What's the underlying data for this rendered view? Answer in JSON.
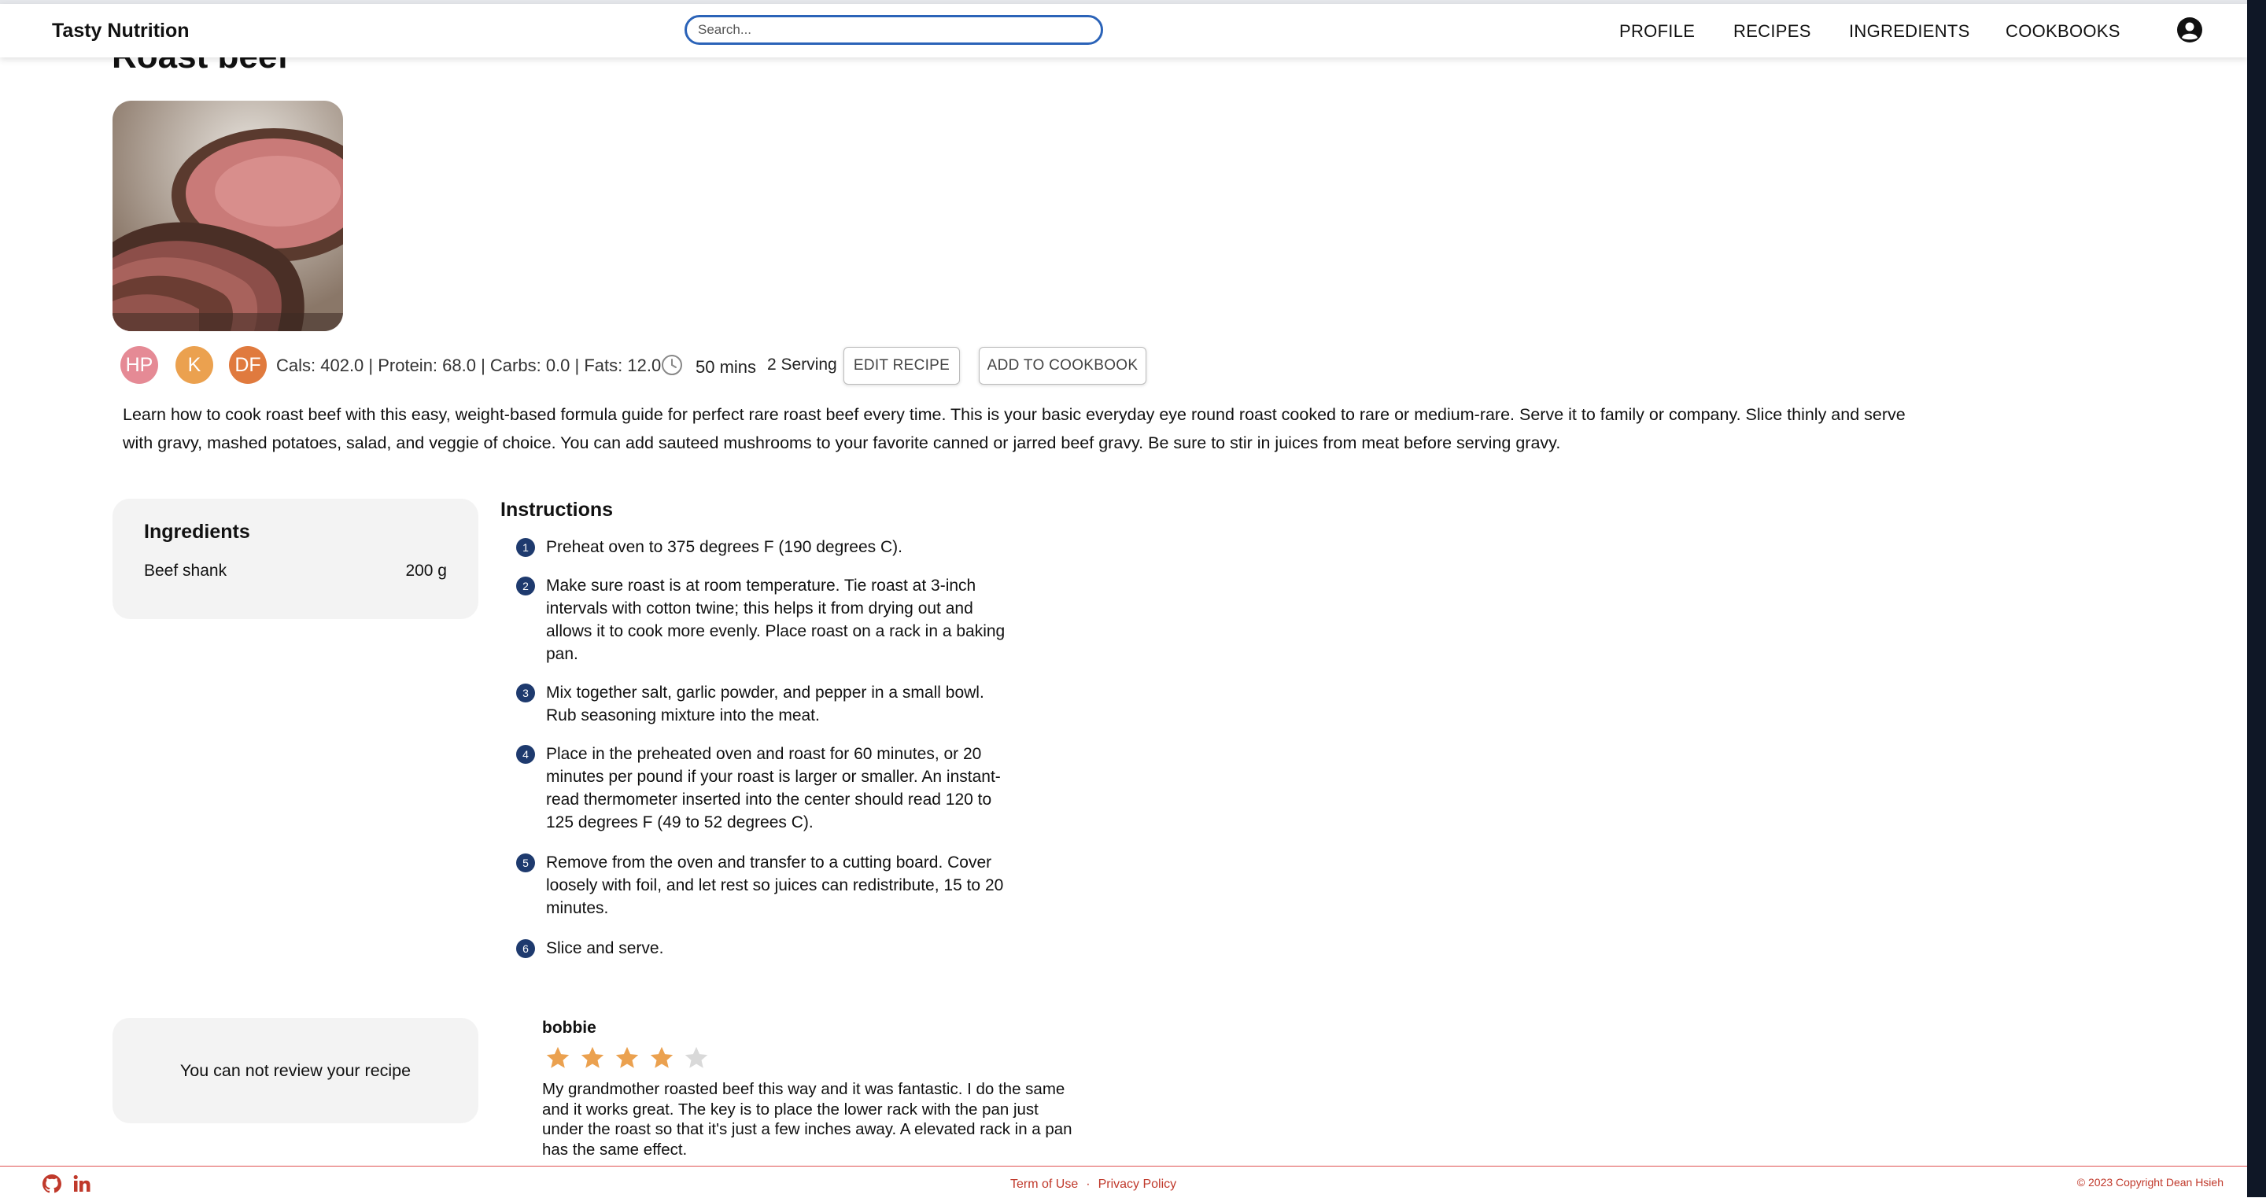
{
  "brand": "Tasty Nutrition",
  "search": {
    "placeholder": "Search..."
  },
  "nav": [
    "PROFILE",
    "RECIPES",
    "INGREDIENTS",
    "COOKBOOKS"
  ],
  "recipe": {
    "title": "Roast beef",
    "tags": [
      {
        "label": "HP",
        "color": "#e58a95"
      },
      {
        "label": "K",
        "color": "#eba14f"
      },
      {
        "label": "DF",
        "color": "#e07a3e"
      }
    ],
    "nutrition": "Cals: 402.0 | Protein: 68.0 | Carbs: 0.0 | Fats: 12.0",
    "time": "50 mins",
    "serving": "2 Serving",
    "edit_label": "EDIT RECIPE",
    "cookbook_label": "ADD TO COOKBOOK",
    "description": "Learn how to cook roast beef with this easy, weight-based formula guide for perfect rare roast beef every time. This is your basic everyday eye round roast cooked to rare or medium-rare. Serve it to family or company. Slice thinly and serve with gravy, mashed potatoes, salad, and veggie of choice. You can add sauteed mushrooms to your favorite canned or jarred beef gravy. Be sure to stir in juices from meat before serving gravy."
  },
  "ingredients": {
    "title": "Ingredients",
    "items": [
      {
        "name": "Beef shank",
        "qty": "200 g"
      }
    ]
  },
  "instructions": {
    "title": "Instructions",
    "steps": [
      {
        "n": "1",
        "text": "Preheat oven to 375 degrees F (190 degrees C)."
      },
      {
        "n": "2",
        "text": "Make sure roast is at room temperature. Tie roast at 3-inch intervals with cotton twine; this helps it from drying out and allows it to cook more evenly. Place roast on a rack in a baking pan."
      },
      {
        "n": "3",
        "text": "Mix together salt, garlic powder, and pepper in a small bowl. Rub seasoning mixture into the meat."
      },
      {
        "n": "4",
        "text": "Place in the preheated oven and roast for 60 minutes, or 20 minutes per pound if your roast is larger or smaller. An instant-read thermometer inserted into the center should read 120 to 125 degrees F (49 to 52 degrees C)."
      },
      {
        "n": "5",
        "text": "Remove from the oven and transfer to a cutting board. Cover loosely with foil, and let rest so juices can redistribute, 15 to 20 minutes."
      },
      {
        "n": "6",
        "text": "Slice and serve."
      }
    ]
  },
  "review_notice": "You can not review your recipe",
  "review": {
    "author": "bobbie",
    "rating": 4,
    "max_rating": 5,
    "text": "My grandmother roasted beef this way and it was fantastic. I do the same and it works great. The key is to place the lower rack with the pan just under the roast so that it's just a few inches away. A elevated rack in a pan has the same effect."
  },
  "footer": {
    "terms": "Term of Use",
    "separator": "·",
    "privacy": "Privacy Policy",
    "copyright": "© 2023 Copyright Dean Hsieh"
  },
  "colors": {
    "star_on": "#eba14f",
    "star_off": "#d9d9d9",
    "step_badge": "#1e3a6e",
    "footer_accent": "#c0392b"
  }
}
